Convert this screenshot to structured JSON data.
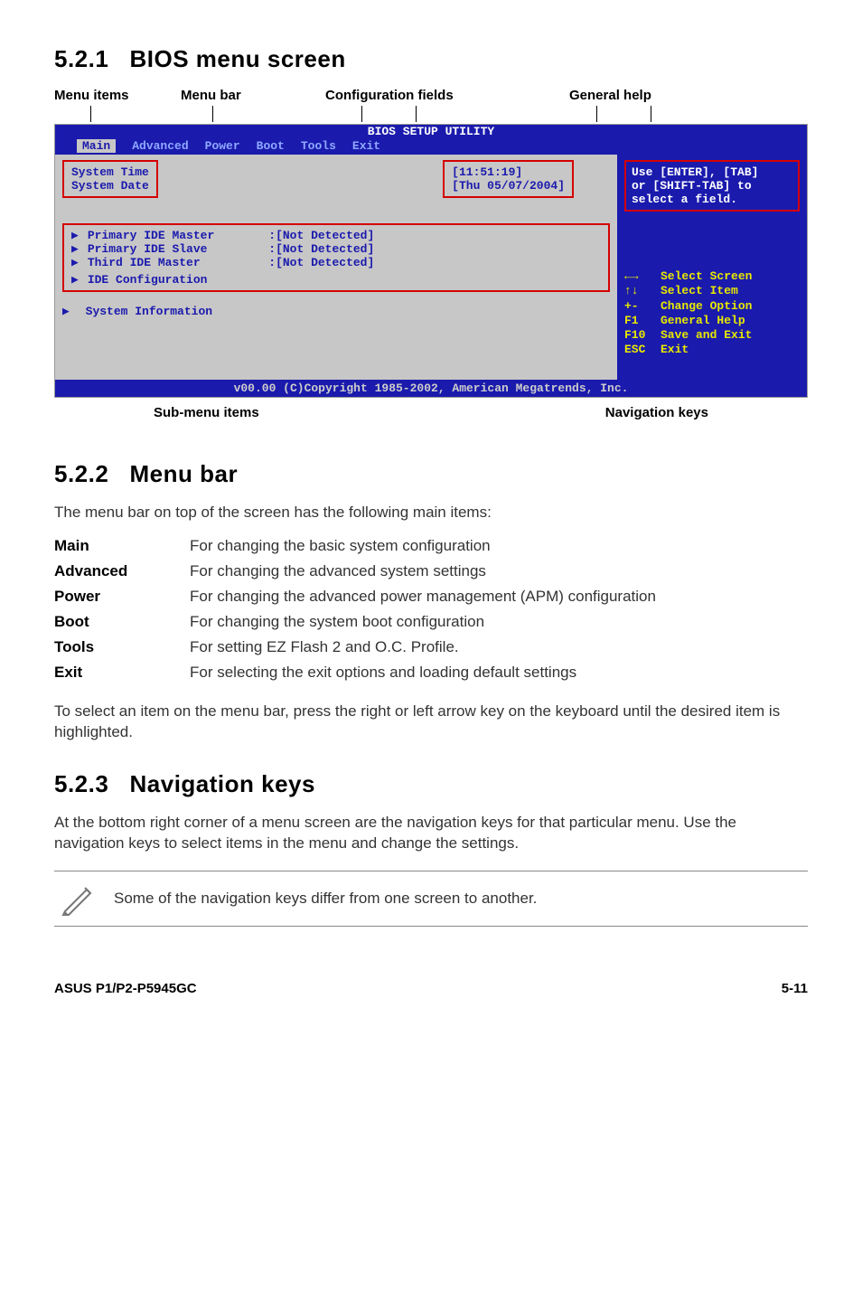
{
  "sections": {
    "s1": {
      "num": "5.2.1",
      "title": "BIOS menu screen"
    },
    "s2": {
      "num": "5.2.2",
      "title": "Menu bar"
    },
    "s3": {
      "num": "5.2.3",
      "title": "Navigation keys"
    }
  },
  "topLabels": {
    "menuItems": "Menu items",
    "menuBar": "Menu bar",
    "configFields": "Configuration fields",
    "generalHelp": "General help"
  },
  "bios": {
    "titleBar": "BIOS SETUP UTILITY",
    "tabs": [
      "Main",
      "Advanced",
      "Power",
      "Boot",
      "Tools",
      "Exit"
    ],
    "left": {
      "sysTimeLabel": "System Time",
      "sysDateLabel": "System Date",
      "sysTimeVal": "[11:51:19]",
      "sysDateVal": "[Thu 05/07/2004]",
      "sub1": "Primary IDE Master",
      "sub2": "Primary IDE Slave",
      "sub3": "Third IDE Master",
      "sub4": "IDE Configuration",
      "subVal": ":[Not Detected]",
      "sysInfo": "System Information"
    },
    "help": {
      "l1": "Use [ENTER], [TAB]",
      "l2": "or [SHIFT-TAB] to",
      "l3": "select a field."
    },
    "nav": {
      "k1": "←→",
      "v1": "Select Screen",
      "k2": "↑↓",
      "v2": "Select Item",
      "k3": "+-",
      "v3": "Change Option",
      "k4": "F1",
      "v4": "General Help",
      "k5": "F10",
      "v5": "Save and Exit",
      "k6": "ESC",
      "v6": "Exit"
    },
    "footer": "v00.00 (C)Copyright 1985-2002, American Megatrends, Inc."
  },
  "bottomLabels": {
    "submenu": "Sub-menu items",
    "navkeys": "Navigation keys"
  },
  "menuBarSection": {
    "intro": "The menu bar on top of the screen has the following main items:",
    "items": [
      {
        "term": "Main",
        "desc": "For changing the basic system configuration"
      },
      {
        "term": "Advanced",
        "desc": "For changing the advanced system settings"
      },
      {
        "term": "Power",
        "desc": "For changing the advanced power management (APM) configuration"
      },
      {
        "term": "Boot",
        "desc": "For changing the system boot configuration"
      },
      {
        "term": "Tools",
        "desc": "For setting EZ Flash 2 and O.C. Profile."
      },
      {
        "term": "Exit",
        "desc": "For selecting the exit options and loading default settings"
      }
    ],
    "outro": "To select an item on the menu bar, press the right or left arrow key on the keyboard until the desired item is highlighted."
  },
  "navSection": {
    "body": "At the bottom right corner of a menu screen are the navigation keys for that particular menu. Use the navigation keys to select items in the menu and change the settings.",
    "note": "Some of the navigation keys differ from one screen to another."
  },
  "pageFooter": {
    "left": "ASUS P1/P2-P5945GC",
    "right": "5-11"
  }
}
